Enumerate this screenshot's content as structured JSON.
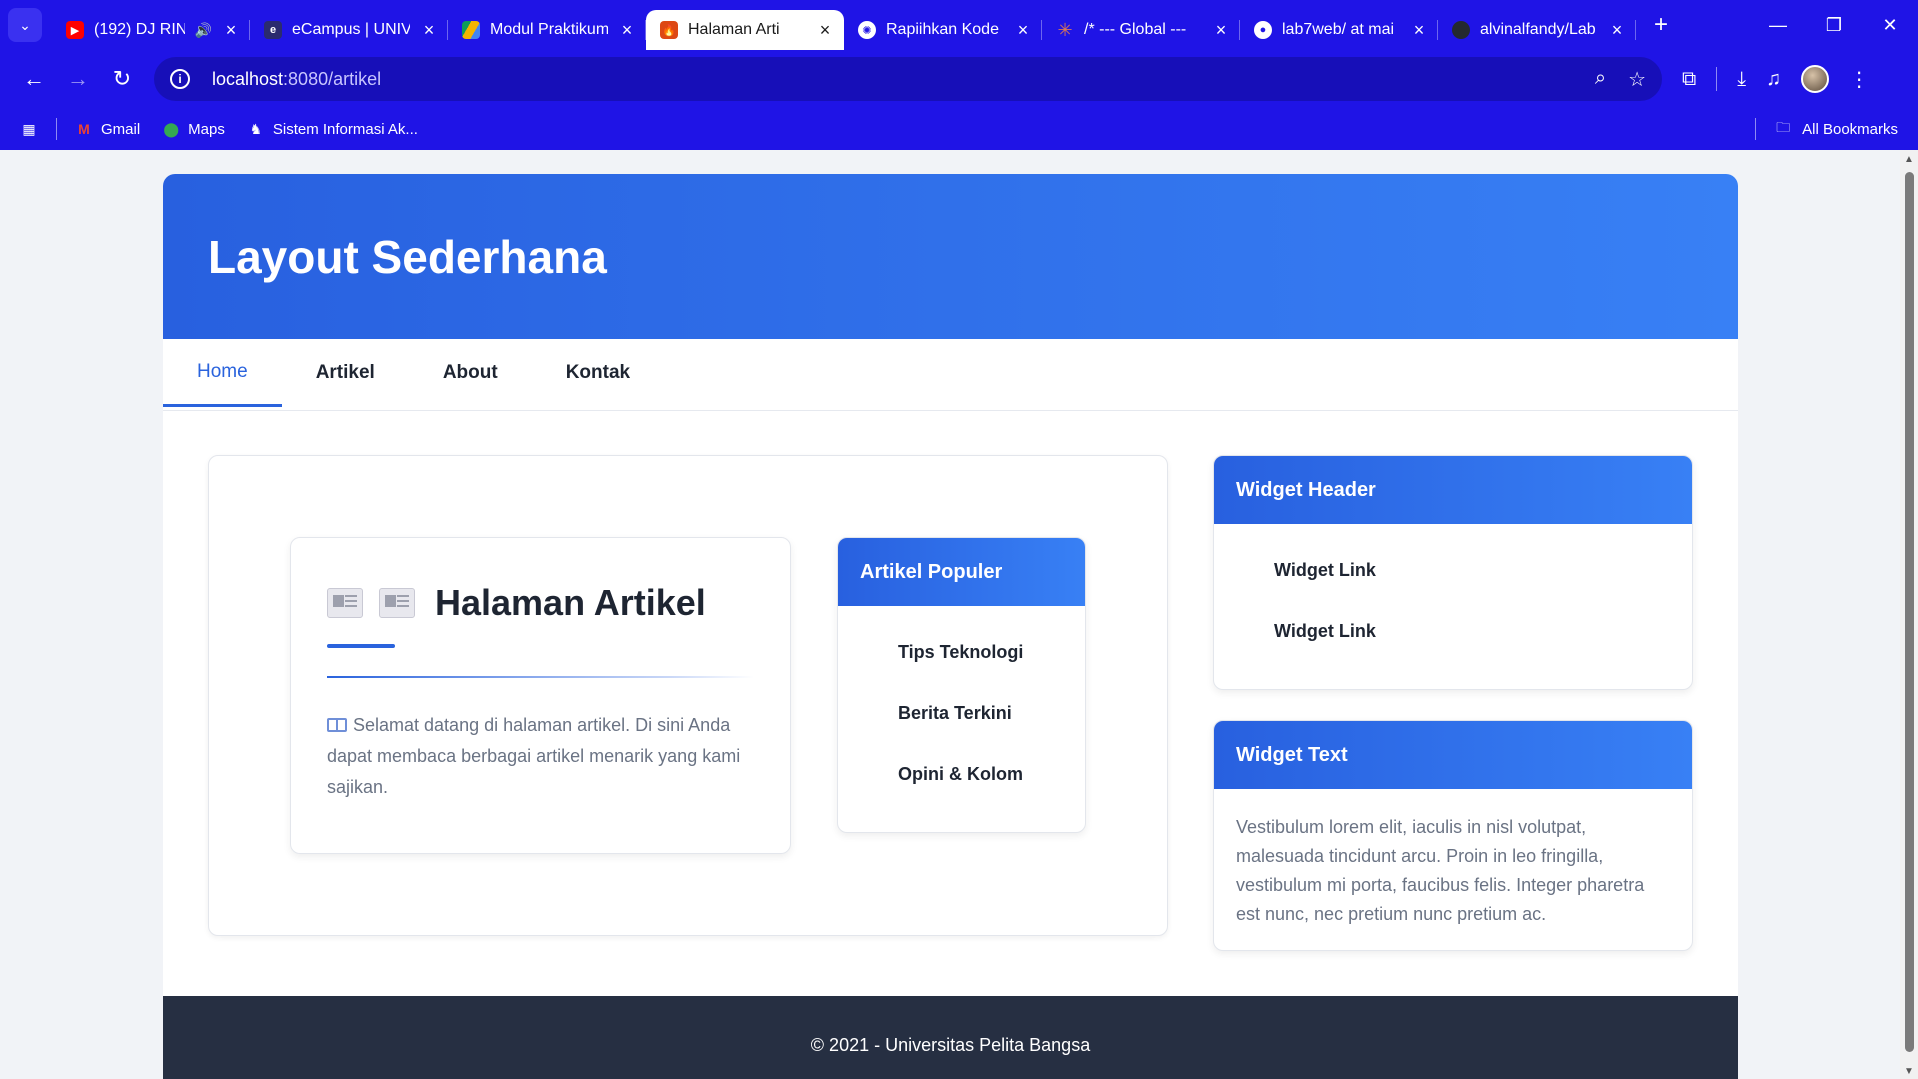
{
  "browser": {
    "tabs": [
      {
        "title": "(192) DJ RIN",
        "favicon": "youtube-icon",
        "color": "#ff0000",
        "muted_audio": true
      },
      {
        "title": "eCampus | UNIV",
        "favicon": "campus-icon",
        "color": "#2b2b6e"
      },
      {
        "title": "Modul Praktikum",
        "favicon": "drive-icon",
        "color": "#f4b400"
      },
      {
        "title": "Halaman Arti",
        "favicon": "codeigniter-icon",
        "color": "#dd4814",
        "active": true
      },
      {
        "title": "Rapiihkan Kode",
        "favicon": "openai-icon",
        "color": "#ffffff"
      },
      {
        "title": "/* --- Global ---",
        "favicon": "claude-icon",
        "color": "#d97757"
      },
      {
        "title": "lab7web/ at mai",
        "favicon": "github-icon",
        "color": "#ffffff"
      },
      {
        "title": "alvinalfandy/Lab",
        "favicon": "github-icon",
        "color": "#ffffff"
      }
    ],
    "url": {
      "host": "localhost",
      "path": ":8080/artikel"
    },
    "bookmarks": [
      {
        "label": "Gmail",
        "icon": "gmail-icon"
      },
      {
        "label": "Maps",
        "icon": "maps-icon"
      },
      {
        "label": "Sistem Informasi Ak...",
        "icon": "sia-icon"
      }
    ],
    "all_bookmarks": "All Bookmarks"
  },
  "site": {
    "title": "Layout Sederhana",
    "nav": [
      {
        "label": "Home",
        "active": true
      },
      {
        "label": "Artikel"
      },
      {
        "label": "About"
      },
      {
        "label": "Kontak"
      }
    ],
    "article": {
      "title": "Halaman Artikel",
      "text": "Selamat datang di halaman artikel. Di sini Anda dapat membaca berbagai artikel menarik yang kami sajikan."
    },
    "popular": {
      "title": "Artikel Populer",
      "items": [
        "Tips Teknologi",
        "Berita Terkini",
        "Opini & Kolom"
      ]
    },
    "widget_header": {
      "title": "Widget Header",
      "links": [
        "Widget Link",
        "Widget Link"
      ]
    },
    "widget_text": {
      "title": "Widget Text",
      "body": "Vestibulum lorem elit, iaculis in nisl volutpat, malesuada tincidunt arcu. Proin in leo fringilla, vestibulum mi porta, faucibus felis. Integer pharetra est nunc, nec pretium nunc pretium ac."
    },
    "footer": "© 2021 - Universitas Pelita Bangsa"
  },
  "colors": {
    "browser_chrome": "#1f14e6",
    "header_blue": "#2a63dd",
    "footer_dark": "#262f42"
  }
}
